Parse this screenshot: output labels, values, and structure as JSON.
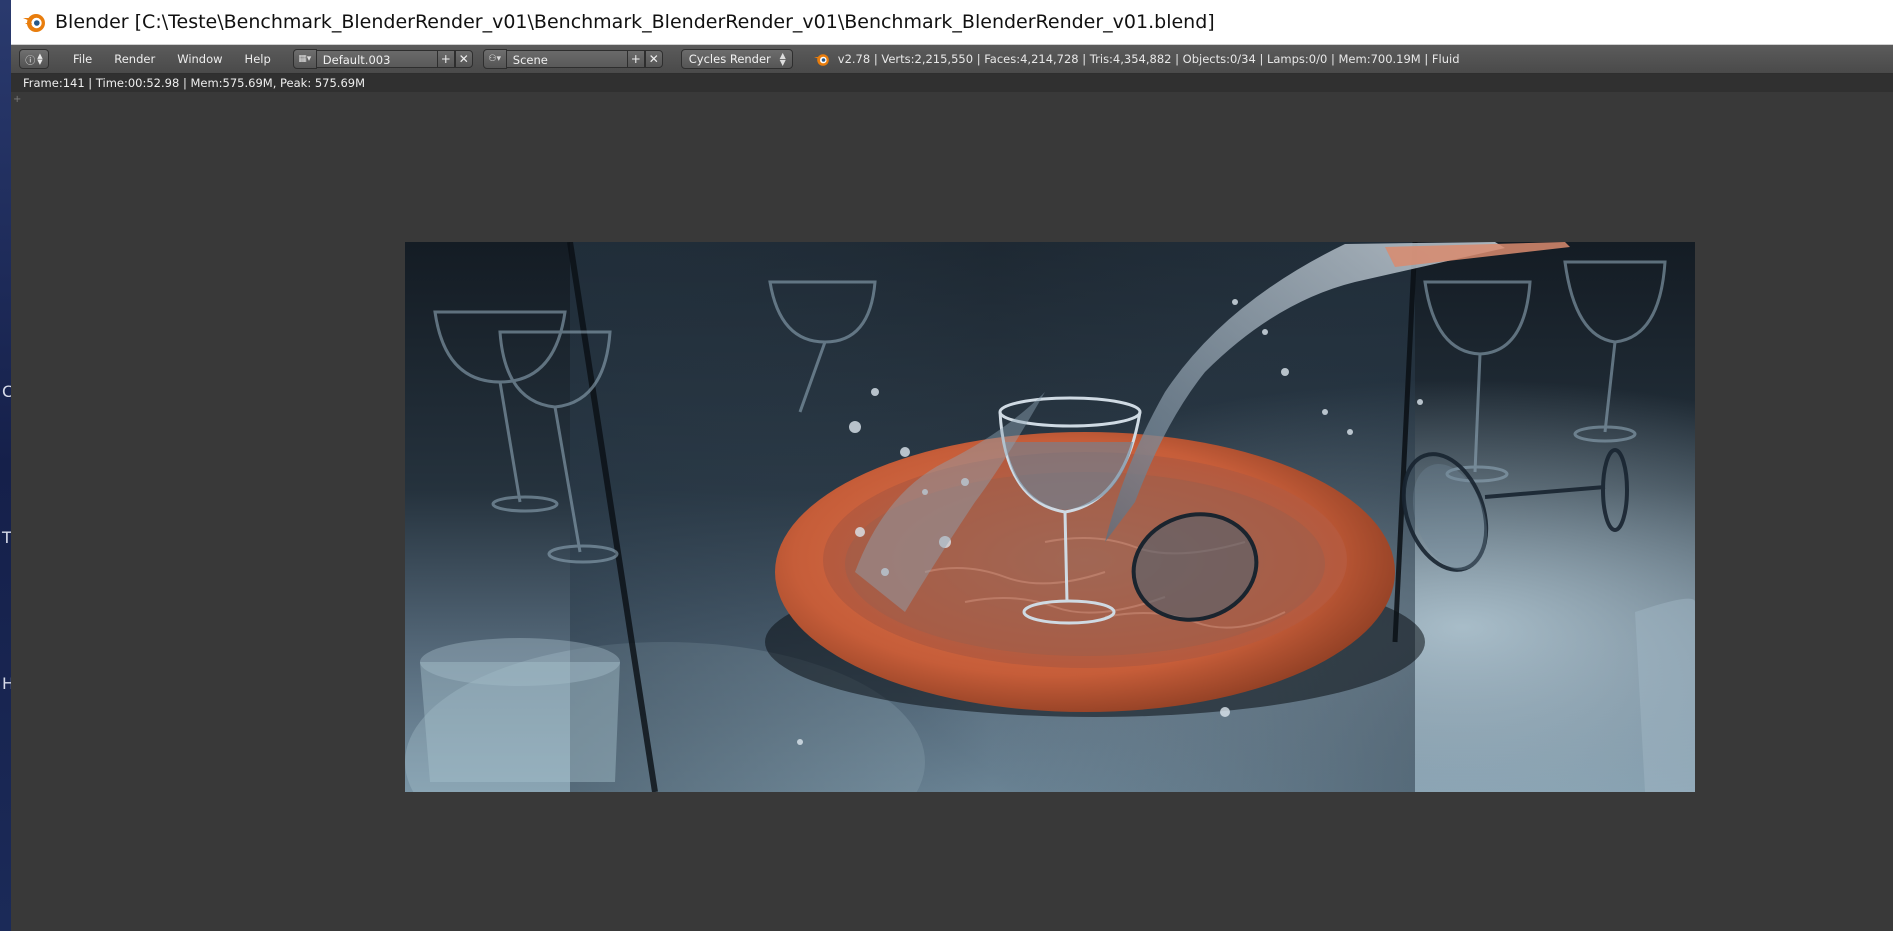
{
  "window": {
    "title": "Blender [C:\\Teste\\Benchmark_BlenderRender_v01\\Benchmark_BlenderRender_v01\\Benchmark_BlenderRender_v01.blend]"
  },
  "desktop_peek": [
    "C",
    "T",
    "H"
  ],
  "header": {
    "menu": [
      "File",
      "Render",
      "Window",
      "Help"
    ],
    "screen_layout": "Default.003",
    "scene": "Scene",
    "render_engine": "Cycles Render",
    "stats": "v2.78 | Verts:2,215,550 | Faces:4,214,728 | Tris:4,354,882 | Objects:0/34 | Lamps:0/0 | Mem:700.19M | Fluid"
  },
  "render_info": "Frame:141 | Time:00:52.98 | Mem:575.69M, Peak: 575.69M",
  "icons": {
    "app": "blender-logo-icon",
    "editor": "info-editor-icon",
    "layout": "screen-layout-icon",
    "scene": "scene-icon",
    "add": "plus-icon",
    "close": "x-icon"
  },
  "colors": {
    "accent": "#e87d0d",
    "header_bg": "#4f4f4f",
    "viewport_bg": "#393939",
    "plate": "#c8623e"
  }
}
